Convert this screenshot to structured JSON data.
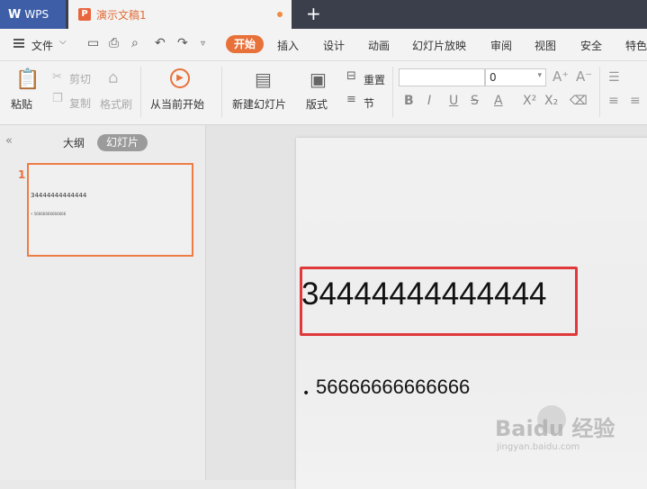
{
  "tabs": {
    "app_label": "WPS",
    "doc_title": "演示文稿1",
    "new_tab": "+"
  },
  "menu": {
    "file": "文件",
    "items": [
      "开始",
      "插入",
      "设计",
      "动画",
      "幻灯片放映",
      "审阅",
      "视图",
      "安全",
      "特色"
    ]
  },
  "ribbon": {
    "paste": "粘贴",
    "cut": "剪切",
    "copy": "复制",
    "format_painter": "格式刷",
    "from_current": "从当前开始",
    "new_slide": "新建幻灯片",
    "layout": "版式",
    "reset": "重置",
    "section": "节",
    "font_size": "0"
  },
  "left_pane": {
    "outline_tab": "大纲",
    "slides_tab": "幻灯片",
    "thumb_number": "1",
    "thumb_title": "34444444444444",
    "thumb_bullet": "• 56666666666666"
  },
  "slide": {
    "title": "34444444444444",
    "bullet": "56666666666666"
  },
  "watermark": {
    "main": "Baidu 经验",
    "sub": "jingyan.baidu.com"
  },
  "colors": {
    "accent": "#e8713a",
    "tab_blue": "#3e5fa8",
    "highlight_box": "#e0393b"
  }
}
